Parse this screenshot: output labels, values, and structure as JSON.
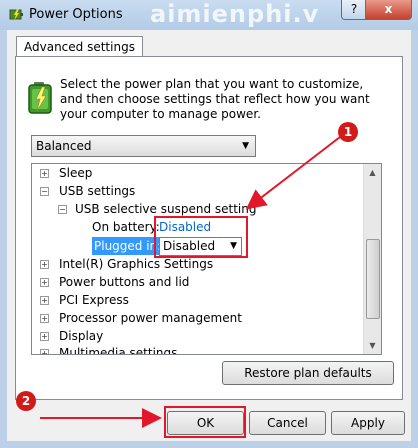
{
  "window": {
    "title": "Power Options",
    "watermark": "aimienphi.v",
    "help_label": "?",
    "close_label": "x"
  },
  "tab": {
    "label": "Advanced settings"
  },
  "description": "Select the power plan that you want to customize, and then choose settings that reflect how you want your computer to manage power.",
  "plan_select": {
    "value": "Balanced"
  },
  "tree": {
    "sleep": "Sleep",
    "usb_settings": "USB settings",
    "usb_suspend": "USB selective suspend setting",
    "on_battery_label": "On battery:",
    "on_battery_value": "Disabled",
    "plugged_in_label": "Plugged in:",
    "plugged_in_value": "Disabled",
    "intel_graphics": "Intel(R) Graphics Settings",
    "power_buttons": "Power buttons and lid",
    "pci_express": "PCI Express",
    "processor": "Processor power management",
    "display": "Display",
    "multimedia": "Multimedia settings"
  },
  "buttons": {
    "restore": "Restore plan defaults",
    "ok": "OK",
    "cancel": "Cancel",
    "apply": "Apply"
  },
  "annotations": {
    "marker_1": "1",
    "marker_2": "2"
  },
  "colors": {
    "highlight": "#e2182a",
    "link": "#0066cc",
    "selection": "#3399ff"
  }
}
